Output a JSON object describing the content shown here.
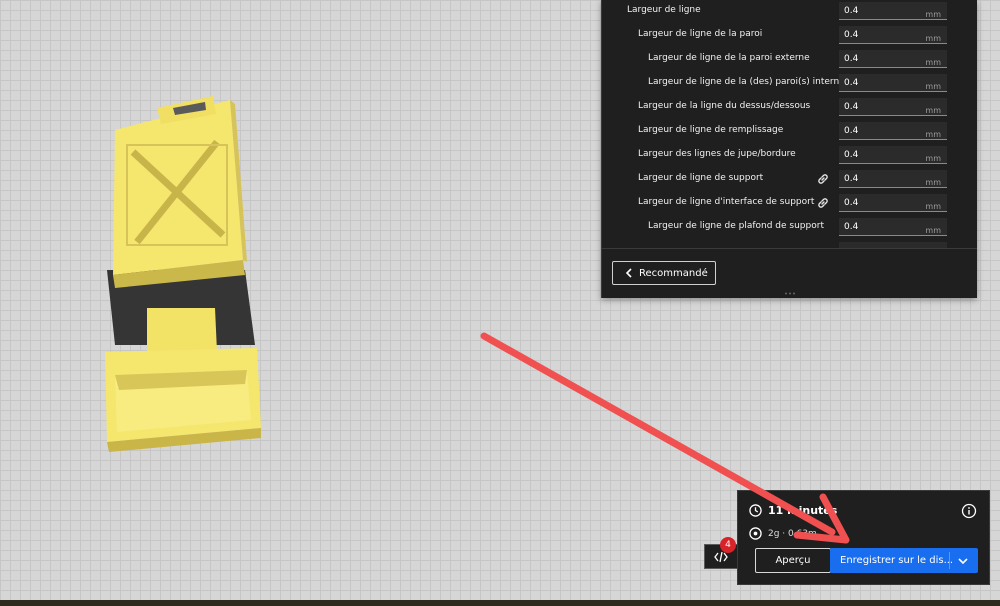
{
  "settings": {
    "rows": [
      {
        "label": "Largeur de ligne",
        "value": "0.4",
        "unit": "mm",
        "linked": false
      },
      {
        "label": "Largeur de ligne de la paroi",
        "value": "0.4",
        "unit": "mm",
        "linked": false
      },
      {
        "label": "Largeur de ligne de la paroi externe",
        "value": "0.4",
        "unit": "mm",
        "linked": false
      },
      {
        "label": "Largeur de ligne de la (des) paroi(s) interne(s)",
        "value": "0.4",
        "unit": "mm",
        "linked": false
      },
      {
        "label": "Largeur de la ligne du dessus/dessous",
        "value": "0.4",
        "unit": "mm",
        "linked": false
      },
      {
        "label": "Largeur de ligne de remplissage",
        "value": "0.4",
        "unit": "mm",
        "linked": false
      },
      {
        "label": "Largeur des lignes de jupe/bordure",
        "value": "0.4",
        "unit": "mm",
        "linked": false
      },
      {
        "label": "Largeur de ligne de support",
        "value": "0.4",
        "unit": "mm",
        "linked": true
      },
      {
        "label": "Largeur de ligne d'interface de support",
        "value": "0.4",
        "unit": "mm",
        "linked": true
      },
      {
        "label": "Largeur de ligne de plafond de support",
        "value": "0.4",
        "unit": "mm",
        "linked": false
      }
    ],
    "recommended_label": "Recommandé"
  },
  "badge": {
    "count": "4"
  },
  "action_panel": {
    "print_time": "11 minutes",
    "material": "2g · 0.63m",
    "preview_label": "Aperçu",
    "save_label": "Enregistrer sur le dis..."
  },
  "colors": {
    "panel_bg": "#1f1f1f",
    "accent_blue": "#196ef0",
    "annotation_arrow": "#f05050",
    "model_yellow": "#f5e66e",
    "badge_red": "#d8232a"
  }
}
